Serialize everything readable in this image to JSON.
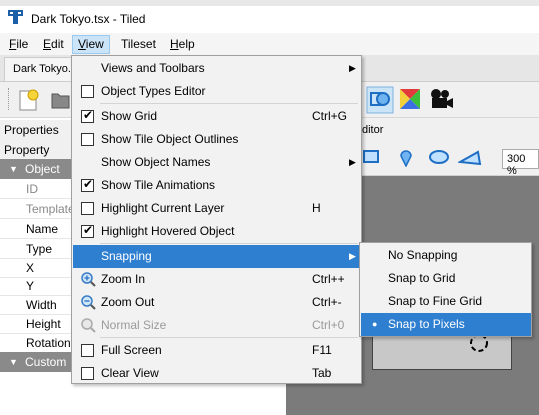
{
  "window": {
    "title": "Dark Tokyo.tsx - Tiled"
  },
  "menubar": [
    "File",
    "Edit",
    "View",
    "Tileset",
    "Help"
  ],
  "doc_tab": "Dark Tokyo.",
  "panel": {
    "title": "Properties",
    "header": "Property",
    "section_object": "Object",
    "fields": [
      "ID",
      "Template",
      "Name",
      "Type",
      "X",
      "Y",
      "Width",
      "Height",
      "Rotation"
    ],
    "section_custom": "Custom"
  },
  "editor_label": "ditor",
  "zoom": "300 %",
  "view_menu": {
    "views_and_toolbars": "Views and Toolbars",
    "object_types_editor": "Object Types Editor",
    "show_grid": "Show Grid",
    "show_grid_shortcut": "Ctrl+G",
    "show_tile_object_outlines": "Show Tile Object Outlines",
    "show_object_names": "Show Object Names",
    "show_tile_animations": "Show Tile Animations",
    "highlight_current_layer": "Highlight Current Layer",
    "highlight_current_layer_shortcut": "H",
    "highlight_hovered_object": "Highlight Hovered Object",
    "snapping": "Snapping",
    "zoom_in": "Zoom In",
    "zoom_in_shortcut": "Ctrl++",
    "zoom_out": "Zoom Out",
    "zoom_out_shortcut": "Ctrl+-",
    "normal_size": "Normal Size",
    "normal_size_shortcut": "Ctrl+0",
    "full_screen": "Full Screen",
    "full_screen_shortcut": "F11",
    "clear_view": "Clear View",
    "clear_view_shortcut": "Tab"
  },
  "snap_menu": {
    "no_snapping": "No Snapping",
    "snap_to_grid": "Snap to Grid",
    "snap_to_fine_grid": "Snap to Fine Grid",
    "snap_to_pixels": "Snap to Pixels"
  },
  "colors": {
    "highlight": "#2f7fd1",
    "section": "#8a8a8a",
    "canvas": "#7b7b7b"
  }
}
